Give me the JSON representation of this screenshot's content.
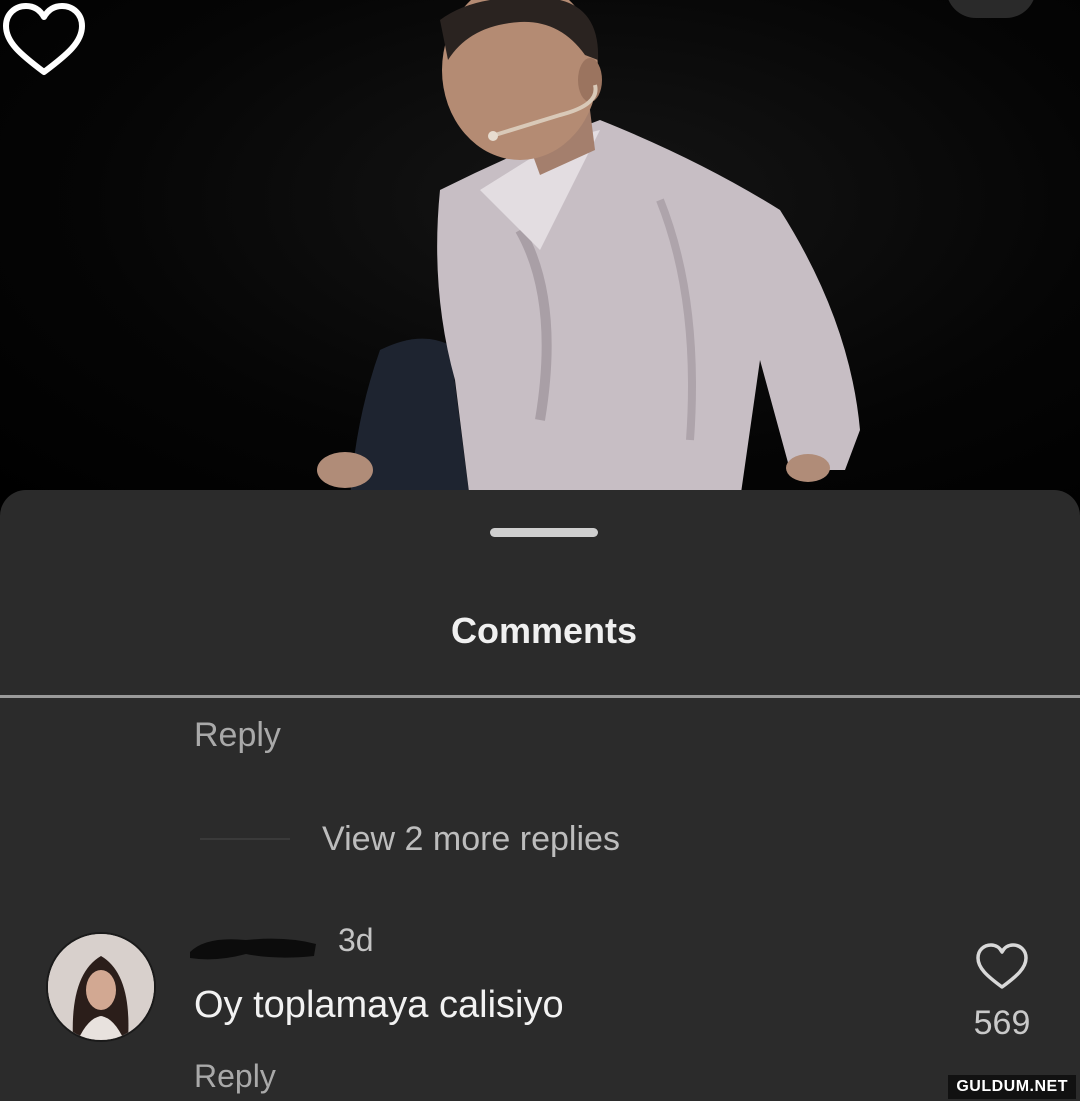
{
  "sheet": {
    "title": "Comments"
  },
  "thread": {
    "reply_label": "Reply",
    "view_more_replies": "View 2 more replies"
  },
  "comment": {
    "time": "3d",
    "text": "Oy toplamaya calisiyo",
    "reply_label": "Reply",
    "like_count": "569"
  },
  "watermark": "GULDUM.NET",
  "icons": {
    "video_like": "heart-outline-icon",
    "comment_like": "heart-outline-icon"
  },
  "colors": {
    "sheet_background": "#2b2b2b",
    "video_background": "#000000"
  }
}
